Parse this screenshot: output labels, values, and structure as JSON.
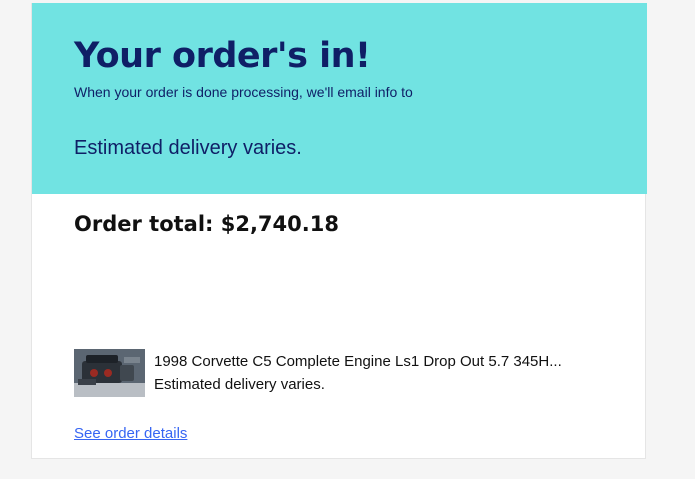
{
  "banner": {
    "title": "Your order's in!",
    "subtitle": "When your order is done processing, we'll email info to",
    "delivery": "Estimated delivery varies.",
    "background_color": "#71e3e2",
    "text_color": "#0f1f66"
  },
  "order": {
    "total_label": "Order total: $2,740.18"
  },
  "item": {
    "thumbnail_icon": "engine-photo",
    "title": "1998 Corvette C5 Complete Engine Ls1 Drop Out 5.7 345H...",
    "delivery": "Estimated delivery varies."
  },
  "links": {
    "order_details": "See order details",
    "link_color": "#3665f3"
  }
}
